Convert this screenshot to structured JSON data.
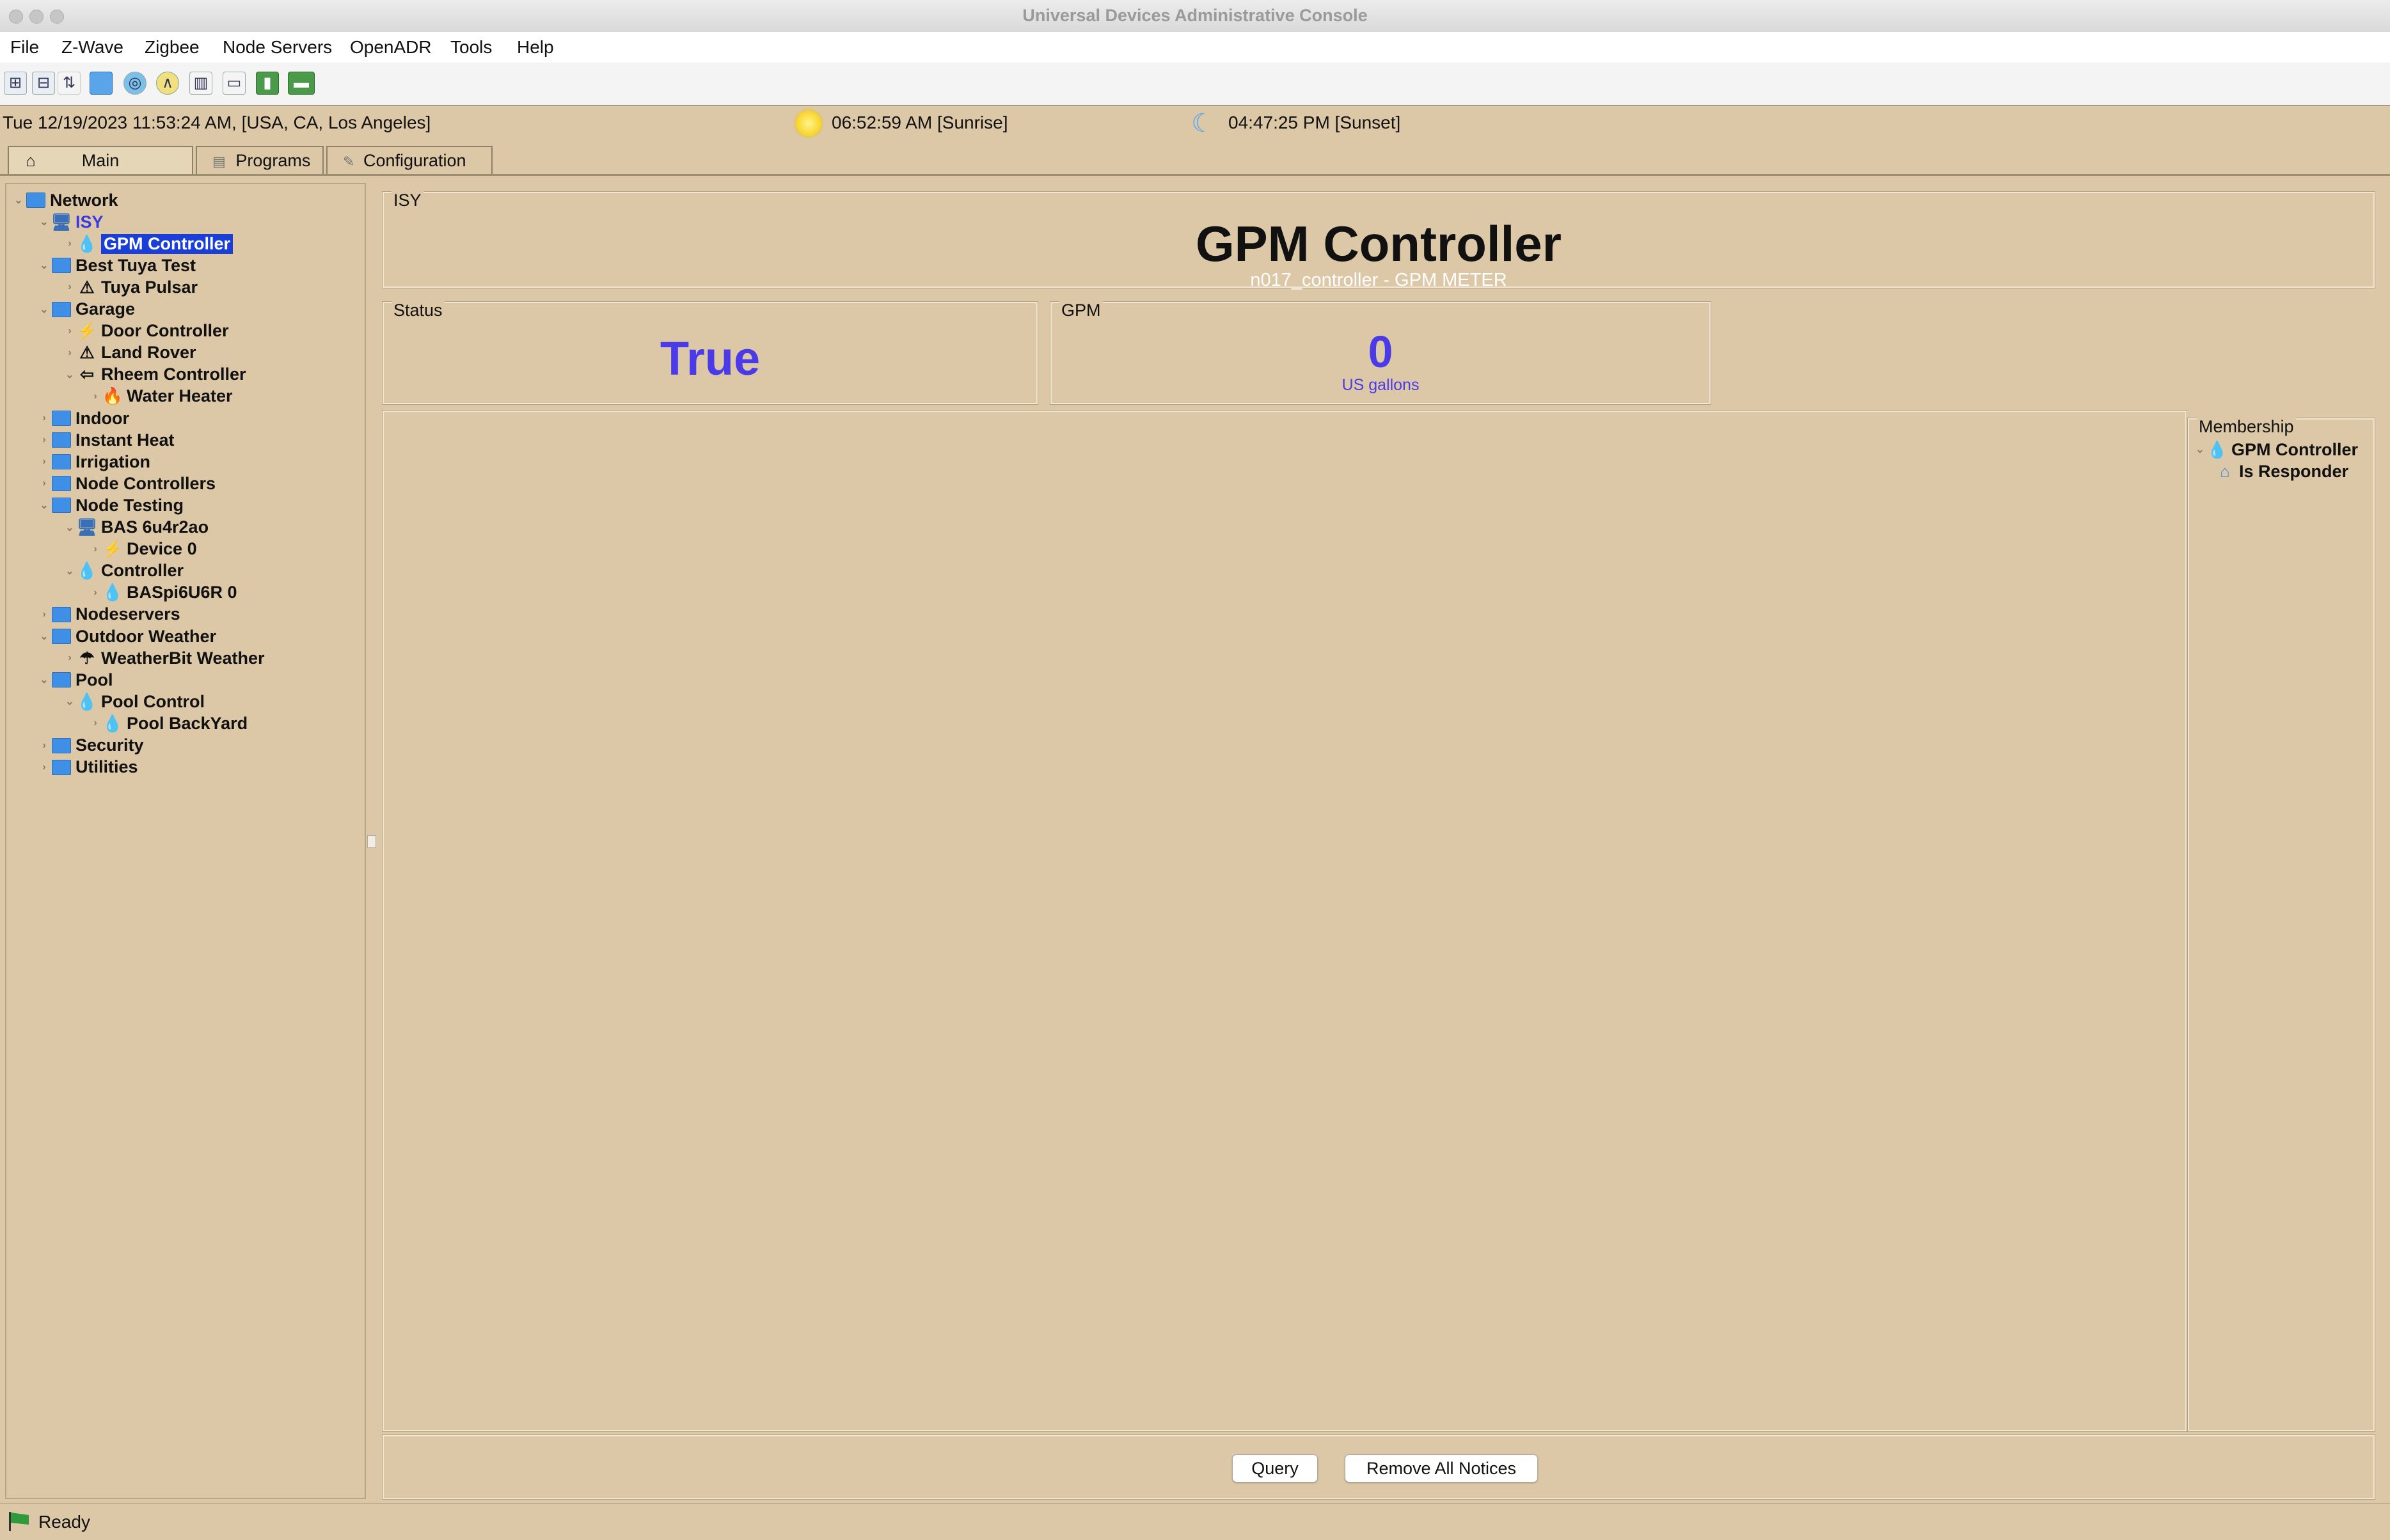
{
  "window": {
    "title": "Universal Devices Administrative Console"
  },
  "menu": [
    "File",
    "Z-Wave",
    "Zigbee",
    "Node Servers",
    "OpenADR",
    "Tools",
    "Help"
  ],
  "toolbar_icons": [
    "expand-all-icon",
    "collapse-all-icon",
    "sort-icon",
    "folder-icon",
    "network-icon",
    "scene-icon",
    "chart-icon",
    "window-icon",
    "battery-icon",
    "card-icon"
  ],
  "info": {
    "datetime": "Tue 12/19/2023 11:53:24 AM,  [USA, CA, Los Angeles]",
    "sunrise": "06:52:59 AM [Sunrise]",
    "sunset": "04:47:25 PM [Sunset]"
  },
  "tabs": {
    "main": "Main",
    "programs": "Programs",
    "configuration": "Configuration"
  },
  "tree": [
    {
      "label": "Network",
      "icon": "folder"
    },
    {
      "label": "ISY",
      "icon": "computer"
    },
    {
      "label": "GPM Controller",
      "icon": "drop"
    },
    {
      "label": "Best Tuya Test",
      "icon": "folder"
    },
    {
      "label": "Tuya Pulsar",
      "icon": "warning"
    },
    {
      "label": "Garage",
      "icon": "folder"
    },
    {
      "label": "Door Controller",
      "icon": "bolt"
    },
    {
      "label": "Land Rover",
      "icon": "warning"
    },
    {
      "label": "Rheem Controller",
      "icon": "arrow"
    },
    {
      "label": "Water Heater",
      "icon": "flame"
    },
    {
      "label": "Indoor",
      "icon": "folder"
    },
    {
      "label": "Instant Heat",
      "icon": "folder"
    },
    {
      "label": "Irrigation",
      "icon": "folder"
    },
    {
      "label": "Node Controllers",
      "icon": "folder"
    },
    {
      "label": "Node Testing",
      "icon": "folder"
    },
    {
      "label": "BAS 6u4r2ao",
      "icon": "computer"
    },
    {
      "label": "Device 0",
      "icon": "bolt"
    },
    {
      "label": "Controller",
      "icon": "drop"
    },
    {
      "label": "BASpi6U6R 0",
      "icon": "drop"
    },
    {
      "label": "Nodeservers",
      "icon": "folder"
    },
    {
      "label": "Outdoor Weather",
      "icon": "folder"
    },
    {
      "label": "WeatherBit Weather",
      "icon": "umbrella"
    },
    {
      "label": "Pool",
      "icon": "folder"
    },
    {
      "label": "Pool Control",
      "icon": "drop"
    },
    {
      "label": "Pool BackYard",
      "icon": "drop"
    },
    {
      "label": "Security",
      "icon": "folder"
    },
    {
      "label": "Utilities",
      "icon": "folder"
    }
  ],
  "panel": {
    "section_label": "ISY",
    "title": "GPM Controller",
    "subtitle": "n017_controller - GPM METER",
    "status_label": "Status",
    "status_value": "True",
    "gpm_label": "GPM",
    "gpm_value": "0",
    "gpm_unit": "US gallons",
    "membership_label": "Membership",
    "membership_items": [
      "GPM Controller",
      "Is Responder"
    ]
  },
  "buttons": {
    "query": "Query",
    "remove_notices": "Remove All Notices"
  },
  "status_bar": {
    "text": "Ready"
  },
  "colors": {
    "background": "#dcc8a6",
    "value": "#4a3ae8",
    "selection": "#1a3fd8"
  }
}
